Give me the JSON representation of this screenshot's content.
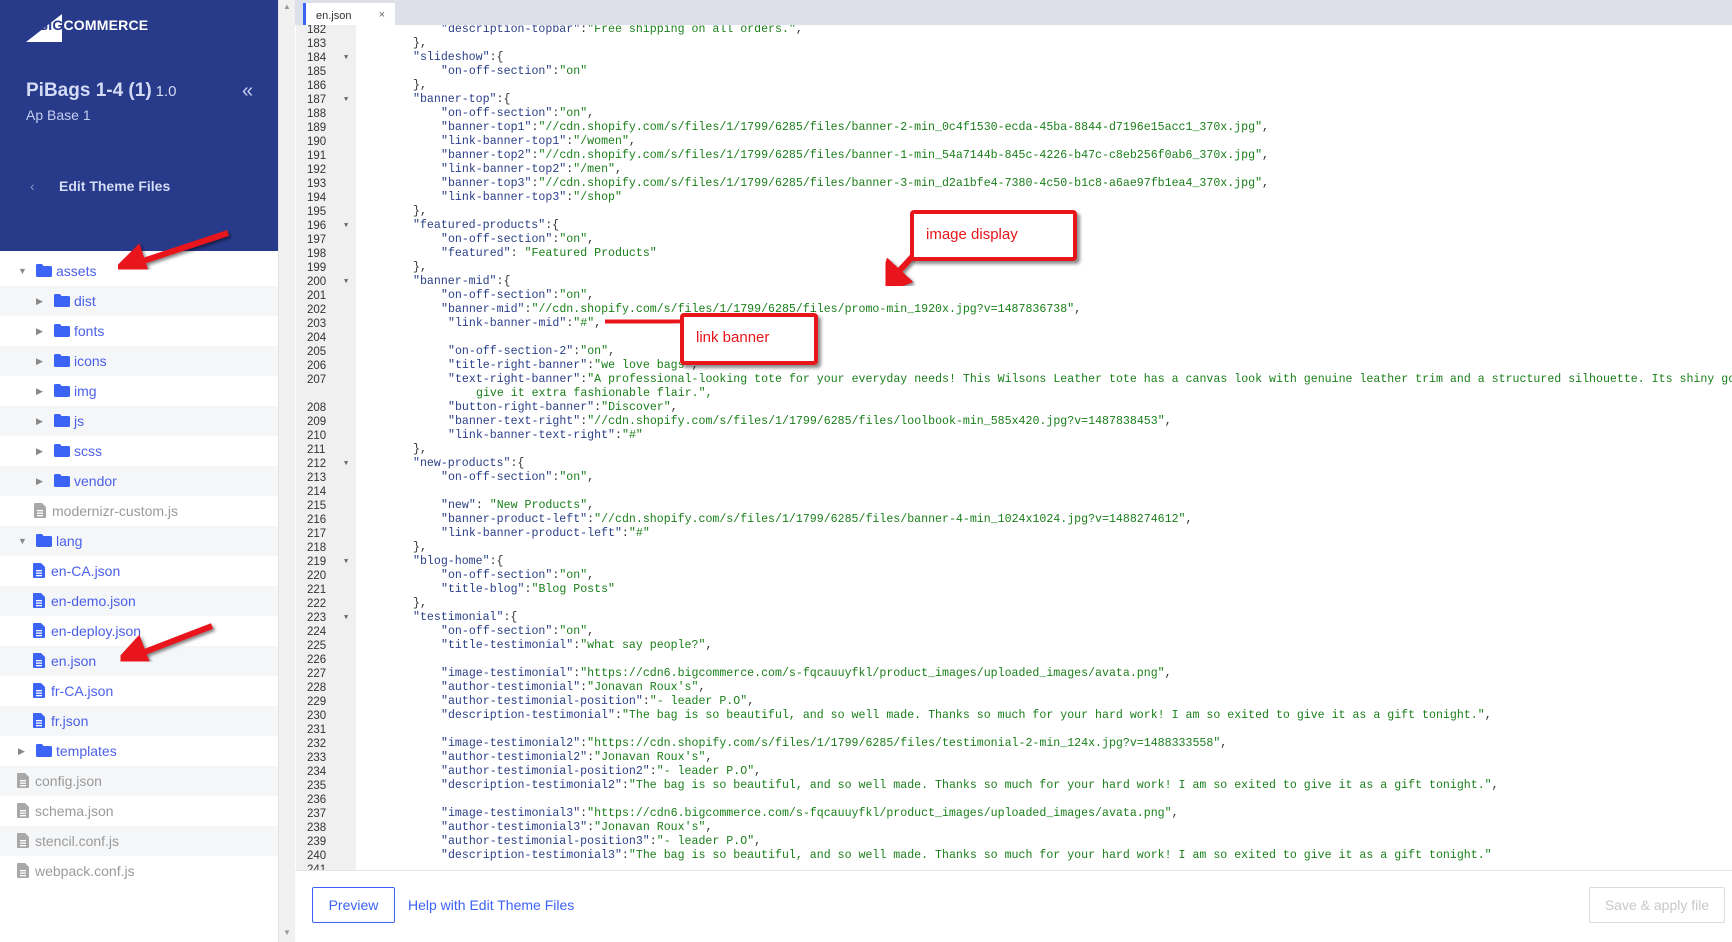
{
  "brand": {
    "logo_big": "BIG",
    "logo_rest": "COMMERCE"
  },
  "theme": {
    "name": "PiBags 1-4 (1)",
    "version": "1.0",
    "variation": "Ap Base 1",
    "section_title": "Edit Theme Files"
  },
  "colors": {
    "sidebar_bg": "#283a8a",
    "accent": "#3c64f4",
    "annotation": "#e8161b",
    "key": "#2a3f87",
    "value": "#1a7f1a"
  },
  "tree": [
    {
      "label": "assets",
      "type": "folder",
      "level": 0,
      "expanded": true
    },
    {
      "label": "dist",
      "type": "folder",
      "level": 1,
      "expanded": false
    },
    {
      "label": "fonts",
      "type": "folder",
      "level": 1,
      "expanded": false
    },
    {
      "label": "icons",
      "type": "folder",
      "level": 1,
      "expanded": false
    },
    {
      "label": "img",
      "type": "folder",
      "level": 1,
      "expanded": false
    },
    {
      "label": "js",
      "type": "folder",
      "level": 1,
      "expanded": false
    },
    {
      "label": "scss",
      "type": "folder",
      "level": 1,
      "expanded": false
    },
    {
      "label": "vendor",
      "type": "folder",
      "level": 1,
      "expanded": false
    },
    {
      "label": "modernizr-custom.js",
      "type": "file-disabled",
      "level": 1
    },
    {
      "label": "lang",
      "type": "folder",
      "level": 0,
      "expanded": true
    },
    {
      "label": "en-CA.json",
      "type": "file",
      "level": 1
    },
    {
      "label": "en-demo.json",
      "type": "file",
      "level": 1
    },
    {
      "label": "en-deploy.json",
      "type": "file",
      "level": 1
    },
    {
      "label": "en.json",
      "type": "file",
      "level": 1,
      "selected": true
    },
    {
      "label": "fr-CA.json",
      "type": "file",
      "level": 1
    },
    {
      "label": "fr.json",
      "type": "file",
      "level": 1
    },
    {
      "label": "templates",
      "type": "folder",
      "level": 0,
      "expanded": false
    },
    {
      "label": "config.json",
      "type": "file-disabled",
      "level": 0
    },
    {
      "label": "schema.json",
      "type": "file-disabled",
      "level": 0
    },
    {
      "label": "stencil.conf.js",
      "type": "file-disabled",
      "level": 0
    },
    {
      "label": "webpack.conf.js",
      "type": "file-disabled",
      "level": 0
    }
  ],
  "editor": {
    "tab": {
      "label": "en.json",
      "close": "×"
    },
    "lines": [
      {
        "n": "182",
        "i": 8,
        "k": "description-topbar",
        "v": "Free shipping on all orders.",
        "p": ","
      },
      {
        "n": "183",
        "i": 4,
        "p": "},"
      },
      {
        "n": "184",
        "fold": true,
        "i": 4,
        "k": "slideshow",
        "p": ":{"
      },
      {
        "n": "185",
        "i": 8,
        "k": "on-off-section",
        "v": "on"
      },
      {
        "n": "186",
        "i": 4,
        "p": "},"
      },
      {
        "n": "187",
        "fold": true,
        "i": 4,
        "k": "banner-top",
        "p": ":{"
      },
      {
        "n": "188",
        "i": 8,
        "k": "on-off-section",
        "v": "on",
        "p": ","
      },
      {
        "n": "189",
        "i": 8,
        "k": "banner-top1",
        "v": "//cdn.shopify.com/s/files/1/1799/6285/files/banner-2-min_0c4f1530-ecda-45ba-8844-d7196e15acc1_370x.jpg",
        "p": ","
      },
      {
        "n": "190",
        "i": 8,
        "k": "link-banner-top1",
        "v": "/women",
        "p": ","
      },
      {
        "n": "191",
        "i": 8,
        "k": "banner-top2",
        "v": "//cdn.shopify.com/s/files/1/1799/6285/files/banner-1-min_54a7144b-845c-4226-b47c-c8eb256f0ab6_370x.jpg",
        "p": ","
      },
      {
        "n": "192",
        "i": 8,
        "k": "link-banner-top2",
        "v": "/men",
        "p": ","
      },
      {
        "n": "193",
        "i": 8,
        "k": "banner-top3",
        "v": "//cdn.shopify.com/s/files/1/1799/6285/files/banner-3-min_d2a1bfe4-7380-4c50-b1c8-a6ae97fb1ea4_370x.jpg",
        "p": ","
      },
      {
        "n": "194",
        "i": 8,
        "k": "link-banner-top3",
        "v": "/shop"
      },
      {
        "n": "195",
        "i": 4,
        "p": "},"
      },
      {
        "n": "196",
        "fold": true,
        "i": 4,
        "k": "featured-products",
        "p": ":{"
      },
      {
        "n": "197",
        "i": 8,
        "k": "on-off-section",
        "v": "on",
        "p": ","
      },
      {
        "n": "198",
        "i": 8,
        "k": "featured",
        "sep": ": ",
        "v": "Featured Products"
      },
      {
        "n": "199",
        "i": 4,
        "p": "},"
      },
      {
        "n": "200",
        "fold": true,
        "i": 4,
        "k": "banner-mid",
        "p": ":{"
      },
      {
        "n": "201",
        "i": 8,
        "k": "on-off-section",
        "v": "on",
        "p": ","
      },
      {
        "n": "202",
        "i": 8,
        "k": "banner-mid",
        "v": "//cdn.shopify.com/s/files/1/1799/6285/files/promo-min_1920x.jpg?v=1487836738",
        "p": ","
      },
      {
        "n": "203",
        "i": 9,
        "k": "link-banner-mid",
        "v": "#",
        "p": ","
      },
      {
        "n": "204",
        "i": 0
      },
      {
        "n": "205",
        "i": 9,
        "k": "on-off-section-2",
        "v": "on",
        "p": ","
      },
      {
        "n": "206",
        "i": 9,
        "k": "title-right-banner",
        "v": "we love bags",
        "p": ","
      },
      {
        "n": "207",
        "i": 9,
        "k": "text-right-banner",
        "v": "A professional-looking tote for your everyday needs! This Wilsons Leather tote has a canvas look with genuine leather trim and a structured silhouette. Its shiny gold-tone ha"
      },
      {
        "n": "",
        "i": 13,
        "v2": "give it extra fashionable flair.",
        "p": "\","
      },
      {
        "n": "208",
        "i": 9,
        "k": "button-right-banner",
        "v": "Discover",
        "p": ","
      },
      {
        "n": "209",
        "i": 9,
        "k": "banner-text-right",
        "v": "//cdn.shopify.com/s/files/1/1799/6285/files/loolbook-min_585x420.jpg?v=1487838453",
        "p": ","
      },
      {
        "n": "210",
        "i": 9,
        "k": "link-banner-text-right",
        "v": "#"
      },
      {
        "n": "211",
        "i": 4,
        "p": "},"
      },
      {
        "n": "212",
        "fold": true,
        "i": 4,
        "k": "new-products",
        "p": ":{"
      },
      {
        "n": "213",
        "i": 8,
        "k": "on-off-section",
        "v": "on",
        "p": ","
      },
      {
        "n": "214",
        "i": 0
      },
      {
        "n": "215",
        "i": 8,
        "k": "new",
        "sep": ": ",
        "v": "New Products",
        "p": ","
      },
      {
        "n": "216",
        "i": 8,
        "k": "banner-product-left",
        "v": "//cdn.shopify.com/s/files/1/1799/6285/files/banner-4-min_1024x1024.jpg?v=1488274612",
        "p": ","
      },
      {
        "n": "217",
        "i": 8,
        "k": "link-banner-product-left",
        "v": "#"
      },
      {
        "n": "218",
        "i": 4,
        "p": "},"
      },
      {
        "n": "219",
        "fold": true,
        "i": 4,
        "k": "blog-home",
        "p": ":{"
      },
      {
        "n": "220",
        "i": 8,
        "k": "on-off-section",
        "v": "on",
        "p": ","
      },
      {
        "n": "221",
        "i": 8,
        "k": "title-blog",
        "v": "Blog Posts"
      },
      {
        "n": "222",
        "i": 4,
        "p": "},"
      },
      {
        "n": "223",
        "fold": true,
        "i": 4,
        "k": "testimonial",
        "p": ":{"
      },
      {
        "n": "224",
        "i": 8,
        "k": "on-off-section",
        "v": "on",
        "p": ","
      },
      {
        "n": "225",
        "i": 8,
        "k": "title-testimonial",
        "v": "what say people?",
        "p": ","
      },
      {
        "n": "226",
        "i": 0
      },
      {
        "n": "227",
        "i": 8,
        "k": "image-testimonial",
        "v": "https://cdn6.bigcommerce.com/s-fqcauuyfkl/product_images/uploaded_images/avata.png",
        "p": ","
      },
      {
        "n": "228",
        "i": 8,
        "k": "author-testimonial",
        "v": "Jonavan Roux's",
        "p": ","
      },
      {
        "n": "229",
        "i": 8,
        "k": "author-testimonial-position",
        "v": "- leader P.O",
        "p": ","
      },
      {
        "n": "230",
        "i": 8,
        "k": "description-testimonial",
        "v": "The bag is so beautiful, and so well made. Thanks so much for your hard work! I am so exited to give it as a gift tonight.",
        "p": ","
      },
      {
        "n": "231",
        "i": 0
      },
      {
        "n": "232",
        "i": 8,
        "k": "image-testimonial2",
        "v": "https://cdn.shopify.com/s/files/1/1799/6285/files/testimonial-2-min_124x.jpg?v=1488333558",
        "p": ","
      },
      {
        "n": "233",
        "i": 8,
        "k": "author-testimonial2",
        "v": "Jonavan Roux's",
        "p": ","
      },
      {
        "n": "234",
        "i": 8,
        "k": "author-testimonial-position2",
        "v": "- leader P.O",
        "p": ","
      },
      {
        "n": "235",
        "i": 8,
        "k": "description-testimonial2",
        "v": "The bag is so beautiful, and so well made. Thanks so much for your hard work! I am so exited to give it as a gift tonight.",
        "p": ","
      },
      {
        "n": "236",
        "i": 0
      },
      {
        "n": "237",
        "i": 8,
        "k": "image-testimonial3",
        "v": "https://cdn6.bigcommerce.com/s-fqcauuyfkl/product_images/uploaded_images/avata.png",
        "p": ","
      },
      {
        "n": "238",
        "i": 8,
        "k": "author-testimonial3",
        "v": "Jonavan Roux's",
        "p": ","
      },
      {
        "n": "239",
        "i": 8,
        "k": "author-testimonial-position3",
        "v": "- leader P.O",
        "p": ","
      },
      {
        "n": "240",
        "i": 8,
        "k": "description-testimonial3",
        "v": "The bag is so beautiful, and so well made. Thanks so much for your hard work! I am so exited to give it as a gift tonight."
      },
      {
        "n": "241",
        "i": 0
      }
    ]
  },
  "footer": {
    "preview": "Preview",
    "help": "Help with Edit Theme Files",
    "save": "Save & apply file"
  },
  "annotations": {
    "image_display": "image display",
    "link_banner": "link banner"
  }
}
